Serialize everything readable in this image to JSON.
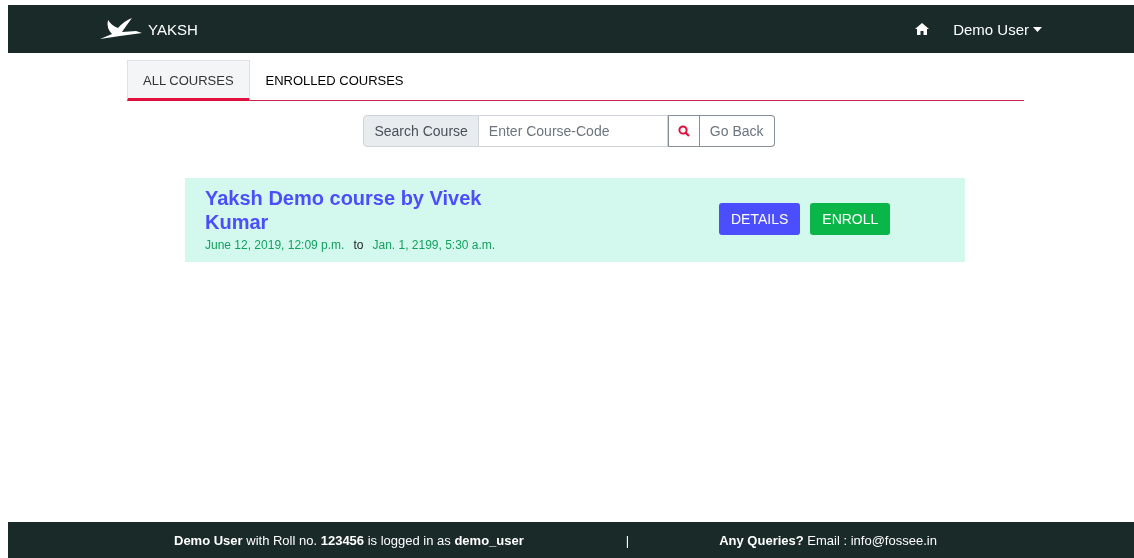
{
  "navbar": {
    "brand": "YAKSH",
    "user_menu": "Demo User"
  },
  "tabs": [
    {
      "label": "ALL COURSES",
      "selected": true
    },
    {
      "label": "ENROLLED COURSES",
      "selected": false
    }
  ],
  "search": {
    "label": "Search Course",
    "placeholder": "Enter Course-Code",
    "back_button": "Go Back"
  },
  "courses": [
    {
      "title": "Yaksh Demo course by Vivek Kumar",
      "start": "June 12, 2019, 12:09 p.m.",
      "separator": "to",
      "end": "Jan. 1, 2199, 5:30 a.m.",
      "buttons": [
        "DETAILS",
        "ENROLL"
      ]
    }
  ],
  "footer": {
    "login_text": "**Demo User** with Roll no. **123456** is logged in as **demo_user**",
    "divider": "|",
    "contact_text": "**Any Queries?** Email : info@fossee.in"
  }
}
